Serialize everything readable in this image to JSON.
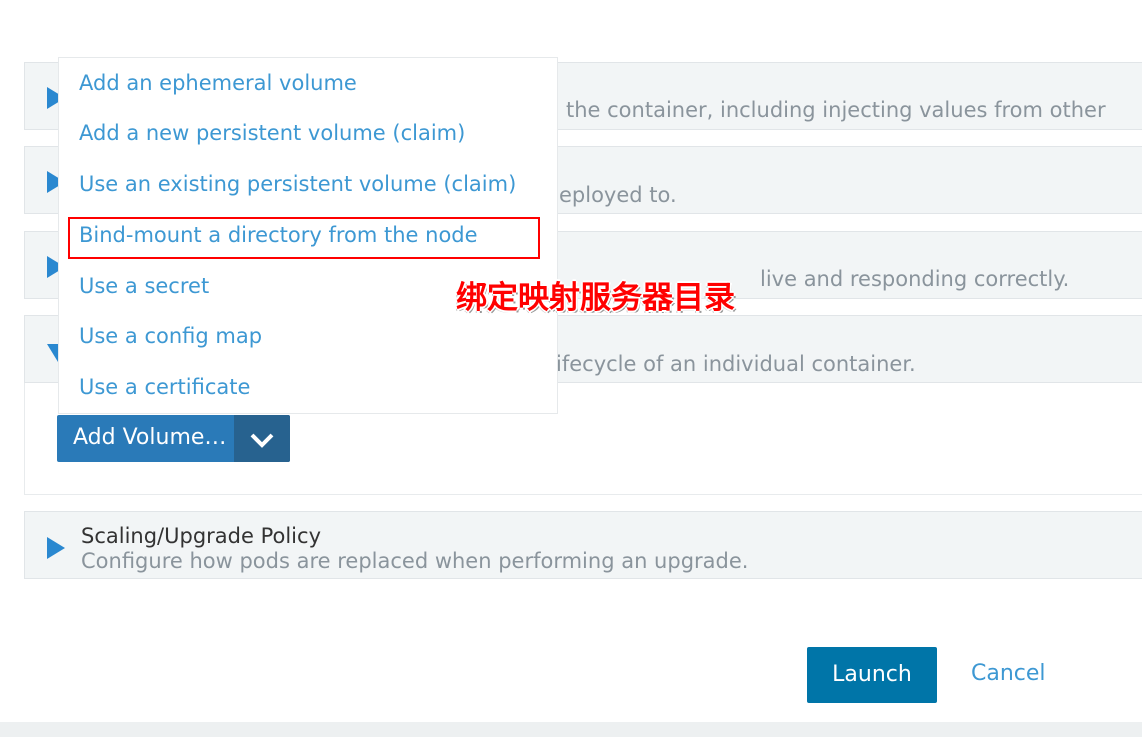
{
  "sections": [
    {
      "description_visible": "the container, including injecting values from other",
      "expanded": false
    },
    {
      "description_visible": "eployed to.",
      "expanded": false
    },
    {
      "description_visible": "live and responding correctly.",
      "expanded": false
    },
    {
      "description_visible": "ifecycle of an individual container.",
      "expanded": true
    },
    {
      "title": "Scaling/Upgrade Policy",
      "description": "Configure how pods are replaced when performing an upgrade.",
      "expanded": false
    }
  ],
  "volume_menu": {
    "items": [
      "Add an ephemeral volume",
      "Add a new persistent volume (claim)",
      "Use an existing persistent volume (claim)",
      "Bind-mount a directory from the node",
      "Use a secret",
      "Use a config map",
      "Use a certificate"
    ],
    "highlighted_item": "Bind-mount a directory from the node"
  },
  "annotation": "绑定映射服务器目录",
  "add_volume_button": "Add Volume…",
  "actions": {
    "launch": "Launch",
    "cancel": "Cancel"
  },
  "colors": {
    "accent": "#3d98d3",
    "button": "#2a7ab8",
    "launch": "#0075a8",
    "annotation": "#ff0000"
  }
}
